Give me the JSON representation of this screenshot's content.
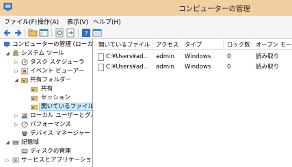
{
  "window": {
    "title": "コンピューターの管理"
  },
  "menu": [
    {
      "label": "ファイル(F)"
    },
    {
      "label": "操作(A)"
    },
    {
      "label": "表示(V)"
    },
    {
      "label": "ヘルプ(H)"
    }
  ],
  "toolbar": {
    "buttons": [
      {
        "icon": "back-arrow-icon"
      },
      {
        "icon": "forward-arrow-icon"
      },
      {
        "icon": "up-folder-icon"
      },
      {
        "icon": "console-tree-icon"
      },
      {
        "icon": "refresh-icon"
      },
      {
        "icon": "export-list-icon"
      },
      {
        "icon": "help-icon"
      },
      {
        "icon": "properties-icon"
      }
    ]
  },
  "tree": {
    "root": "コンピューターの管理 (ローカル)",
    "system_tools": "システム ツール",
    "task_scheduler": "タスク スケジューラ",
    "event_viewer": "イベント ビューアー",
    "shared_folders": "共有フォルダー",
    "shares": "共有",
    "sessions": "セッション",
    "open_files": "開いているファイル",
    "local_users": "ローカル ユーザーとグループ",
    "performance": "パフォーマンス",
    "device_manager": "デバイス マネージャー",
    "storage": "記憶域",
    "disk_management": "ディスクの管理",
    "services_apps": "サービスとアプリケーション"
  },
  "list": {
    "columns": [
      "開いているファイル",
      "アクセス",
      "タイプ",
      "ロック数",
      "オープン モード"
    ],
    "rows": [
      {
        "file": "C:¥Users¥ad...",
        "access": "admin",
        "type": "Windows",
        "locks": "0",
        "mode": "読み取り"
      },
      {
        "file": "C:¥Users¥ad...",
        "access": "admin",
        "type": "Windows",
        "locks": "0",
        "mode": "読み取り"
      }
    ]
  },
  "colors": {
    "titlebar": "#f2cf9e",
    "selection": "#cde8ff",
    "accent": "#3a77c8"
  }
}
